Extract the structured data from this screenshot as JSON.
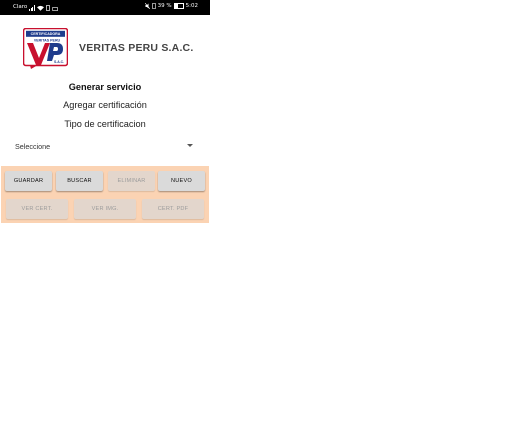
{
  "status_bar": {
    "carrier": "Claro",
    "battery_percent": "39 %",
    "time": "5:02"
  },
  "header": {
    "company_name": "VERITAS PERU S.A.C.",
    "logo_text_top": "CERTIFICADORA",
    "logo_text_mid": "VERITAS PERU",
    "logo_text_bottom": "S.A.C.",
    "logo_letters": "VP"
  },
  "main": {
    "generar_servicio": "Generar servicio",
    "agregar_certificacion": "Agregar certificación",
    "tipo_certificacion": "Tipo de certificacion",
    "dropdown_value": "Seleccione"
  },
  "buttons": {
    "guardar": "GUARDAR",
    "buscar": "BUSCAR",
    "eliminar": "ELIMINAR",
    "nuevo": "NUEVO",
    "ver_cert": "VER CERT.",
    "ver_img": "VER IMG.",
    "cert_pdf": "CERT. PDF"
  },
  "colors": {
    "panel_bg": "#fbd3b3",
    "logo_red": "#c8102e",
    "logo_blue": "#1f3c8c"
  }
}
